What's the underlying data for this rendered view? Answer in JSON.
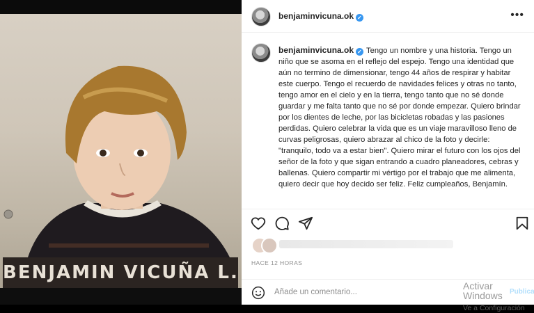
{
  "photo": {
    "caption": "BENJAMIN VICUÑA L."
  },
  "post": {
    "username": "benjaminvicuna.ok",
    "verified": true,
    "caption": "Tengo un nombre y una historia. Tengo un niño que se asoma en el reflejo del espejo. Tengo una identidad que aún no termino de dimensionar, tengo 44 años de respirar y habitar este cuerpo. Tengo el recuerdo de navidades felices y otras no tanto, tengo amor en el cielo y en la tierra, tengo tanto que no sé donde guardar y me falta tanto que no sé por donde empezar. Quiero brindar por los dientes de leche, por las bicicletas robadas y las pasiones perdidas. Quiero celebrar la vida que es un viaje maravilloso lleno de curvas peligrosas, quiero abrazar al chico de la foto y decirle: \"tranquilo, todo va a estar bien\". Quiero mirar el futuro con los ojos del señor de la foto y que sigan entrando a cuadro planeadores, cebras y ballenas. Quiero compartir mi vértigo por el trabajo que me alimenta, quiero decir que hoy decido ser feliz. Feliz cumpleaños, Benjamín.",
    "timestamp": "HACE 12 HORAS",
    "comment_placeholder": "Añade un comentario...",
    "publish_label": "Publicar"
  },
  "icons": [
    "more-icon",
    "heart-icon",
    "comment-icon",
    "share-icon",
    "bookmark-icon",
    "emoji-icon"
  ],
  "watermark": {
    "line1": "Activar Windows",
    "line2": "Ve a Configuración"
  },
  "colors": {
    "verified": "#3897f0",
    "text": "#262626",
    "muted": "#8e8e8e",
    "publish": "#b2dffc"
  }
}
